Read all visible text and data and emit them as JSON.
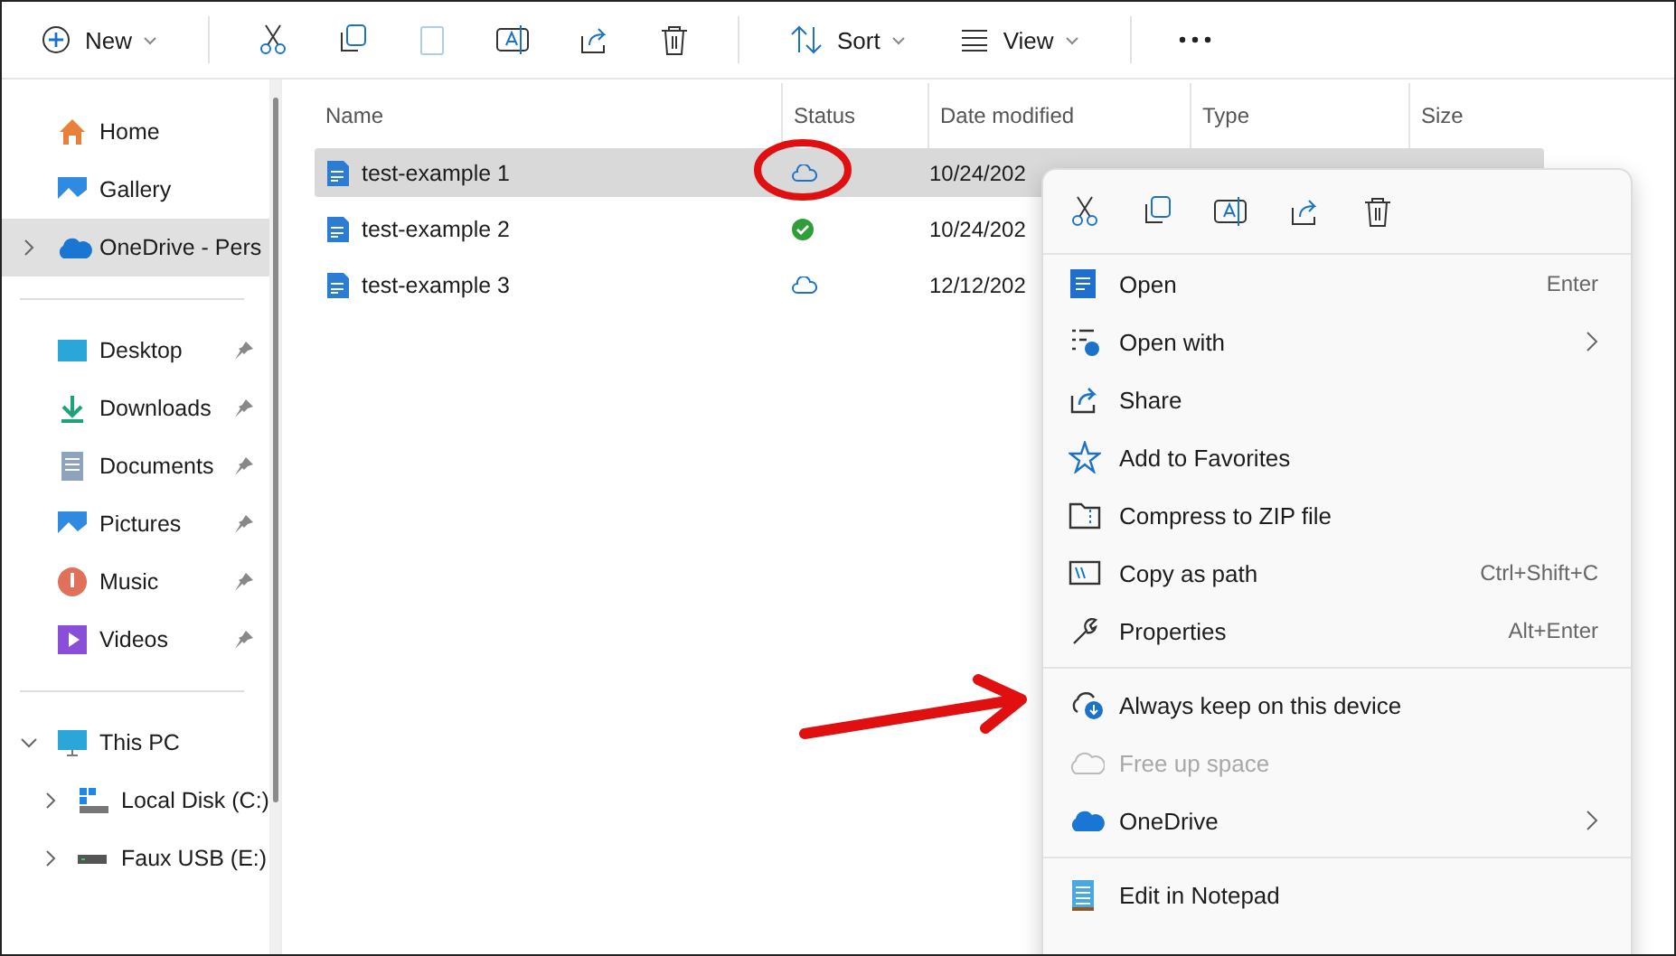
{
  "toolbar": {
    "new_label": "New",
    "sort_label": "Sort",
    "view_label": "View",
    "paste_disabled": true
  },
  "sidebar": {
    "items": [
      {
        "label": "Home",
        "selected": false,
        "pinned": false
      },
      {
        "label": "Gallery",
        "selected": false,
        "pinned": false
      },
      {
        "label": "OneDrive - Pers",
        "selected": true,
        "pinned": false,
        "expanded": false
      },
      {
        "label": "Desktop",
        "selected": false,
        "pinned": true
      },
      {
        "label": "Downloads",
        "selected": false,
        "pinned": true
      },
      {
        "label": "Documents",
        "selected": false,
        "pinned": true
      },
      {
        "label": "Pictures",
        "selected": false,
        "pinned": true
      },
      {
        "label": "Music",
        "selected": false,
        "pinned": true
      },
      {
        "label": "Videos",
        "selected": false,
        "pinned": true
      },
      {
        "label": "This PC",
        "selected": false,
        "pinned": false,
        "expanded": true,
        "children": [
          {
            "label": "Local Disk (C:)",
            "expanded": false
          },
          {
            "label": "Faux USB (E:)",
            "expanded": false
          }
        ]
      }
    ]
  },
  "table": {
    "columns": [
      "Name",
      "Status",
      "Date modified",
      "Type",
      "Size"
    ],
    "rows": [
      {
        "name": "test-example 1",
        "synced": false,
        "date": "10/24/202",
        "selected": true
      },
      {
        "name": "test-example 2",
        "synced": true,
        "date": "10/24/202",
        "selected": false
      },
      {
        "name": "test-example 3",
        "synced": false,
        "date": "12/12/202",
        "selected": false
      }
    ]
  },
  "context_menu": {
    "items": [
      {
        "label": "Open",
        "shortcut": "Enter",
        "submenu": false,
        "disabled": false
      },
      {
        "label": "Open with",
        "submenu": true,
        "disabled": false
      },
      {
        "label": "Share",
        "submenu": false,
        "disabled": false
      },
      {
        "label": "Add to Favorites",
        "submenu": false,
        "disabled": false
      },
      {
        "label": "Compress to ZIP file",
        "submenu": false,
        "disabled": false
      },
      {
        "label": "Copy as path",
        "shortcut": "Ctrl+Shift+C",
        "submenu": false,
        "disabled": false
      },
      {
        "label": "Properties",
        "shortcut": "Alt+Enter",
        "submenu": false,
        "disabled": false
      },
      {
        "label": "Always keep on this device",
        "submenu": false,
        "disabled": false,
        "separator_before": true
      },
      {
        "label": "Free up space",
        "submenu": false,
        "disabled": true
      },
      {
        "label": "OneDrive",
        "submenu": true,
        "disabled": false
      },
      {
        "label": "Edit in Notepad",
        "submenu": false,
        "disabled": false,
        "separator_before": true
      }
    ]
  }
}
